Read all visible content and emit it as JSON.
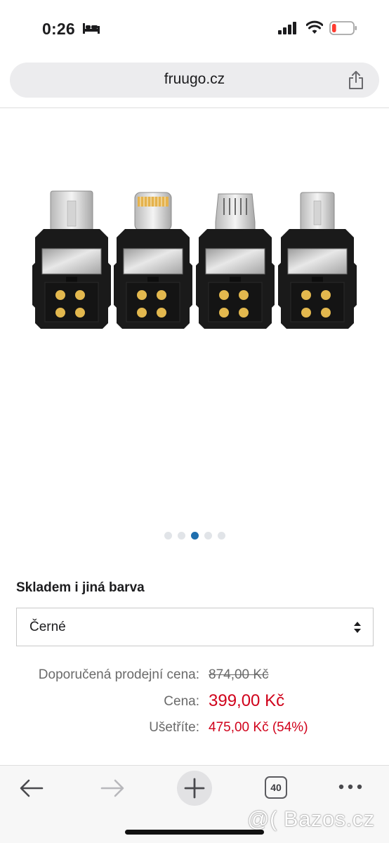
{
  "status_bar": {
    "time": "0:26",
    "icons": [
      "bed-icon",
      "signal-icon",
      "wifi-icon",
      "battery-icon"
    ],
    "battery_level": 0.1,
    "battery_color": "#ff3b30"
  },
  "browser": {
    "url": "fruugo.cz",
    "share_icon": "share-icon"
  },
  "gallery": {
    "total_images": 5,
    "active_index": 2,
    "active_color": "#1f6fae"
  },
  "product": {
    "variant_label": "Skladem i jiná barva",
    "variant_selected": "Černé",
    "rrp_label": "Doporučená prodejní cena:",
    "rrp_value": "874,00 Kč",
    "price_label": "Cena:",
    "price_value": "399,00 Kč",
    "savings_label": "Ušetříte:",
    "savings_value": "475,00 Kč (54%)",
    "price_color": "#d0021b"
  },
  "toolbar": {
    "tabs_count": "40",
    "icons": [
      "back-arrow-icon",
      "forward-arrow-icon",
      "plus-icon",
      "tabs-icon",
      "more-icon"
    ]
  },
  "watermark": {
    "text": "@( Bazos.cz"
  }
}
